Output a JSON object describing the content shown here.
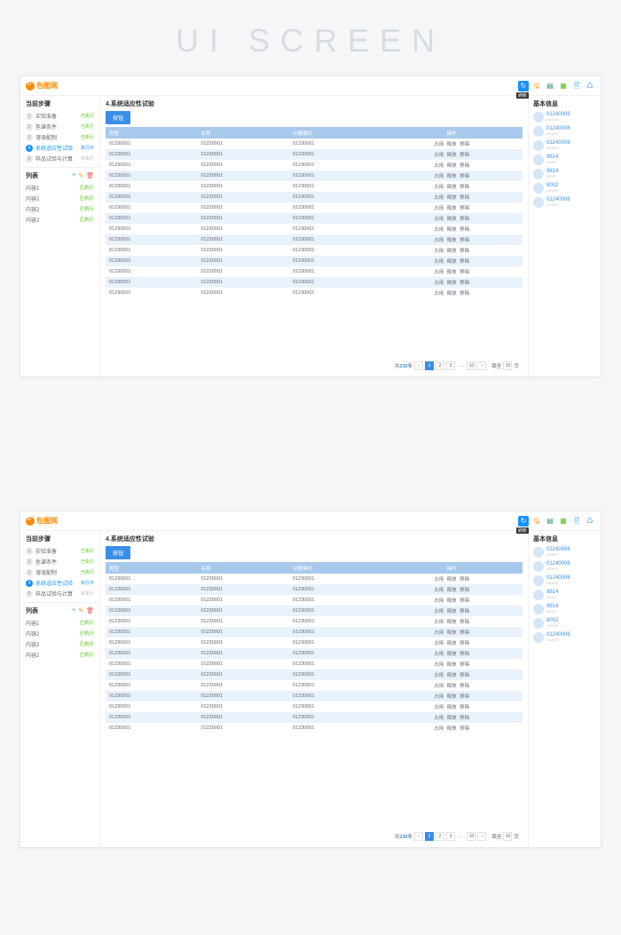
{
  "page_title": "UI SCREEN",
  "logo": {
    "text": "包图网"
  },
  "topbar": {
    "refresh_label": "刷新"
  },
  "steps_panel": {
    "title": "当前步骤",
    "steps": [
      {
        "num": "1",
        "name": "实验准备",
        "status": "已执行",
        "status_class": "stat-done"
      },
      {
        "num": "2",
        "name": "色谱条件",
        "status": "已执行",
        "status_class": "stat-done"
      },
      {
        "num": "3",
        "name": "溶液配制",
        "status": "已执行",
        "status_class": "stat-done"
      },
      {
        "num": "4",
        "name": "系统适应性试验",
        "status": "执行中",
        "status_class": "stat-run",
        "active": true
      },
      {
        "num": "5",
        "name": "样品试验与计算",
        "status": "未执行",
        "status_class": "stat-pending"
      }
    ]
  },
  "list_panel": {
    "title": "列表",
    "items": [
      {
        "name": "内容1",
        "status": "已执行"
      },
      {
        "name": "内容2",
        "status": "已执行"
      },
      {
        "name": "内容2",
        "status": "已执行"
      },
      {
        "name": "内容2",
        "status": "已执行"
      }
    ]
  },
  "main": {
    "title": "4.系统适应性试验",
    "button_label": "按钮",
    "headers": {
      "type": "类型",
      "name": "名称",
      "code": "仪器编码",
      "ops": "操作"
    },
    "cell_value": "01230001",
    "ops": {
      "a": "占用",
      "b": "释放",
      "c": "移除"
    },
    "row_count": 15,
    "pagination": {
      "total_prefix": "共",
      "total_num": "230",
      "total_suffix": "条",
      "pages": [
        "1",
        "2",
        "3"
      ],
      "last": "10",
      "jump_label": "跳至",
      "jump_val": "10",
      "jump_suffix": "页"
    }
  },
  "info_panel": {
    "title": "基本信息",
    "items": [
      {
        "id": "01240006",
        "sub": "XXXXX"
      },
      {
        "id": "01240006",
        "sub": "XXXXX"
      },
      {
        "id": "01240006",
        "sub": "XXXXX"
      },
      {
        "id": "9814",
        "sub": "XXXX"
      },
      {
        "id": "9814",
        "sub": "XXXX"
      },
      {
        "id": "8002",
        "sub": "XXXXX"
      },
      {
        "id": "01240006",
        "sub": "XXXXX"
      }
    ]
  }
}
